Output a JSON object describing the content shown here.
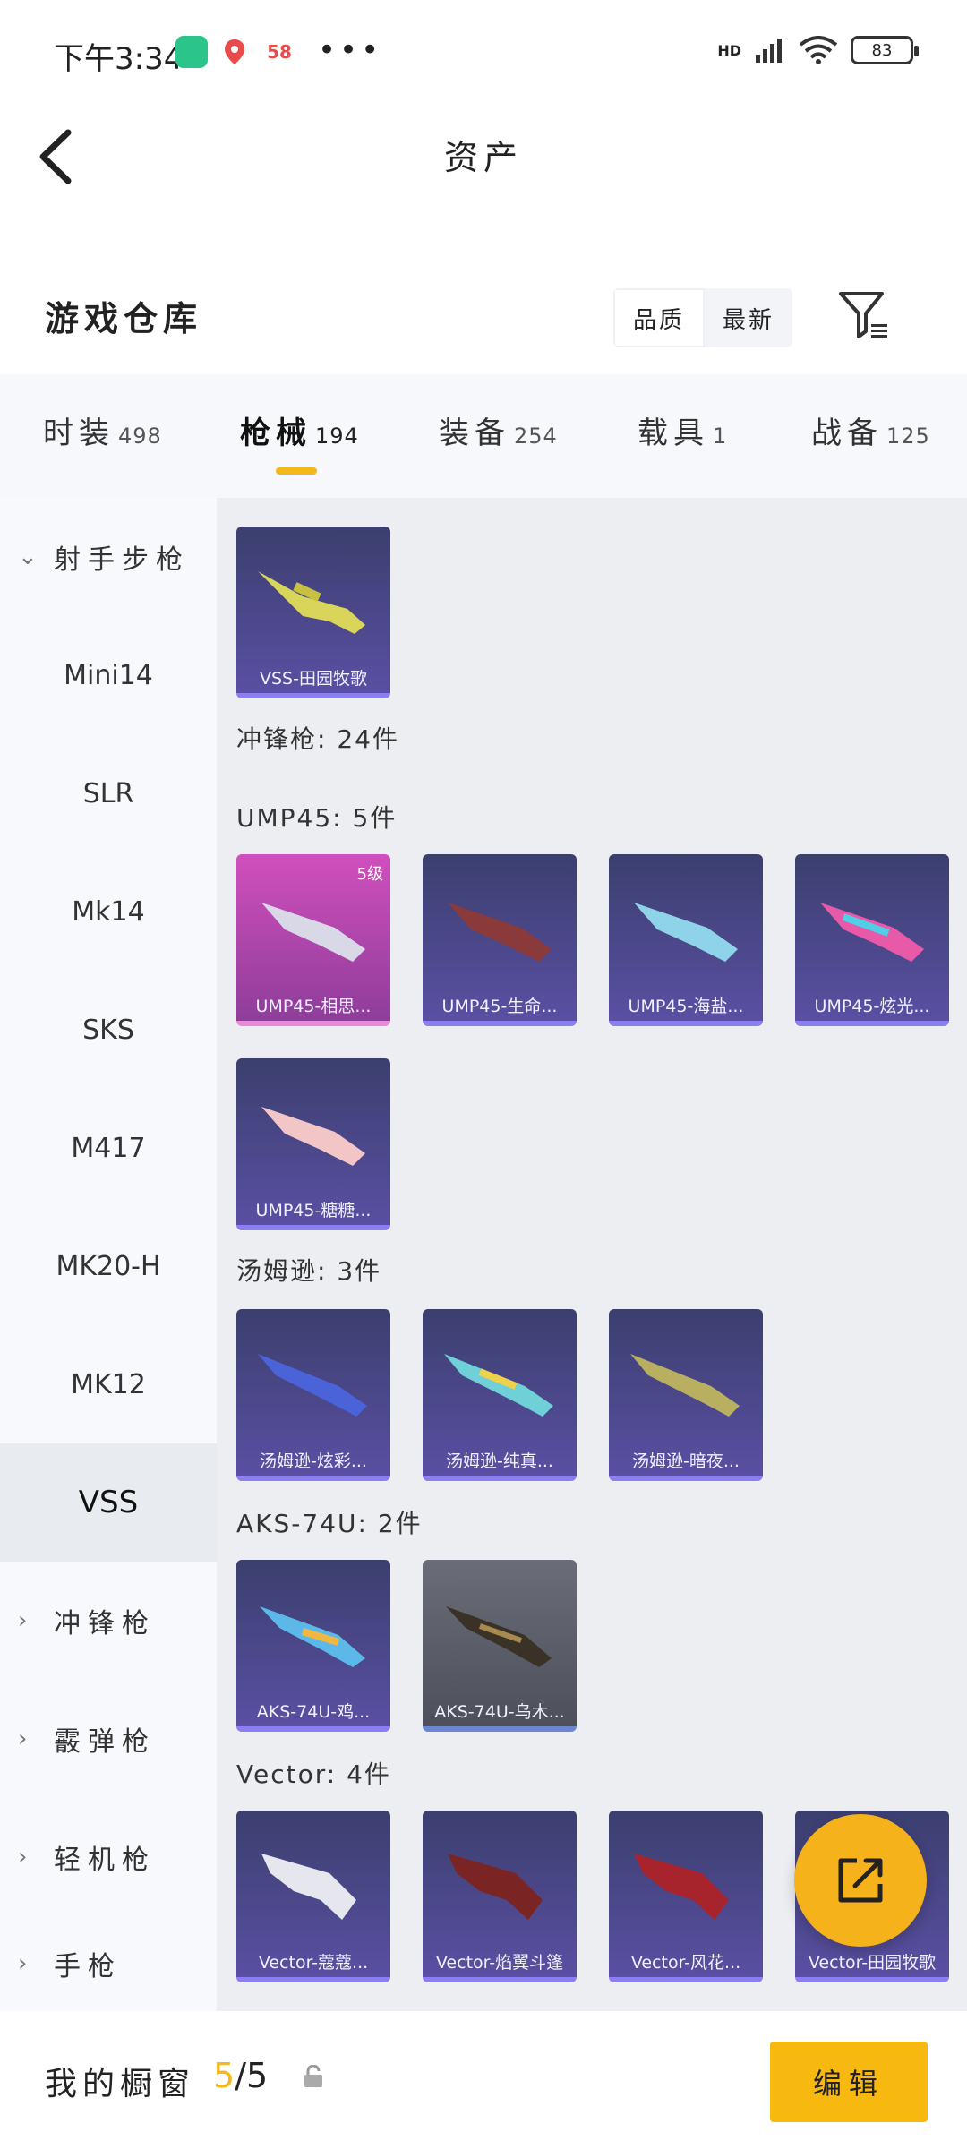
{
  "status_bar": {
    "time": "下午3:34",
    "apps": [
      {
        "icon": "green-shield-app-icon",
        "color": "#2bc48a"
      },
      {
        "icon": "location-pin-app-icon",
        "color": "#e94b4b"
      },
      {
        "icon": "58-app-icon",
        "color": "#f5a623",
        "label": "58"
      }
    ],
    "more": "•••",
    "signal": "HD",
    "battery": "83"
  },
  "header": {
    "title": "资产",
    "back_icon": "chevron-left-icon"
  },
  "warehouse": {
    "title": "游戏仓库",
    "sort": [
      "品质",
      "最新"
    ],
    "filter_icon": "filter-icon"
  },
  "tabs": [
    {
      "label": "时装",
      "count": "498"
    },
    {
      "label": "枪械",
      "count": "194",
      "active": true
    },
    {
      "label": "装备",
      "count": "254"
    },
    {
      "label": "载具",
      "count": "1"
    },
    {
      "label": "战备",
      "count": "125"
    }
  ],
  "sidebar": {
    "group_open": "射手步枪",
    "items": [
      "Mini14",
      "SLR",
      "Mk14",
      "SKS",
      "M417",
      "MK20-H",
      "MK12",
      "VSS"
    ],
    "active": "VSS",
    "groups_closed": [
      "冲锋枪",
      "霰弹枪",
      "轻机枪",
      "手枪"
    ]
  },
  "content": {
    "vss_card": {
      "name": "VSS-田园牧歌"
    },
    "smg_header": "冲锋枪: 24件",
    "ump_header": "UMP45: 5件",
    "ump_cards": [
      {
        "name": "UMP45-相思...",
        "level": "5级",
        "color": "pink"
      },
      {
        "name": "UMP45-生命..."
      },
      {
        "name": "UMP45-海盐..."
      },
      {
        "name": "UMP45-炫光..."
      },
      {
        "name": "UMP45-糖糖..."
      }
    ],
    "tommy_header": "汤姆逊: 3件",
    "tommy_cards": [
      {
        "name": "汤姆逊-炫彩..."
      },
      {
        "name": "汤姆逊-纯真..."
      },
      {
        "name": "汤姆逊-暗夜..."
      }
    ],
    "aks_header": "AKS-74U: 2件",
    "aks_cards": [
      {
        "name": "AKS-74U-鸡..."
      },
      {
        "name": "AKS-74U-乌木...",
        "color": "grey"
      }
    ],
    "vector_header": "Vector: 4件",
    "vector_cards": [
      {
        "name": "Vector-蔻蔻..."
      },
      {
        "name": "Vector-焰翼斗篷"
      },
      {
        "name": "Vector-风花..."
      },
      {
        "name": "Vector-田园牧歌"
      }
    ]
  },
  "fab_icon": "share-out-icon",
  "bottom": {
    "label": "我的橱窗",
    "current": "5",
    "sep_total": "/5",
    "lock_icon": "lock-icon",
    "edit": "编辑"
  }
}
